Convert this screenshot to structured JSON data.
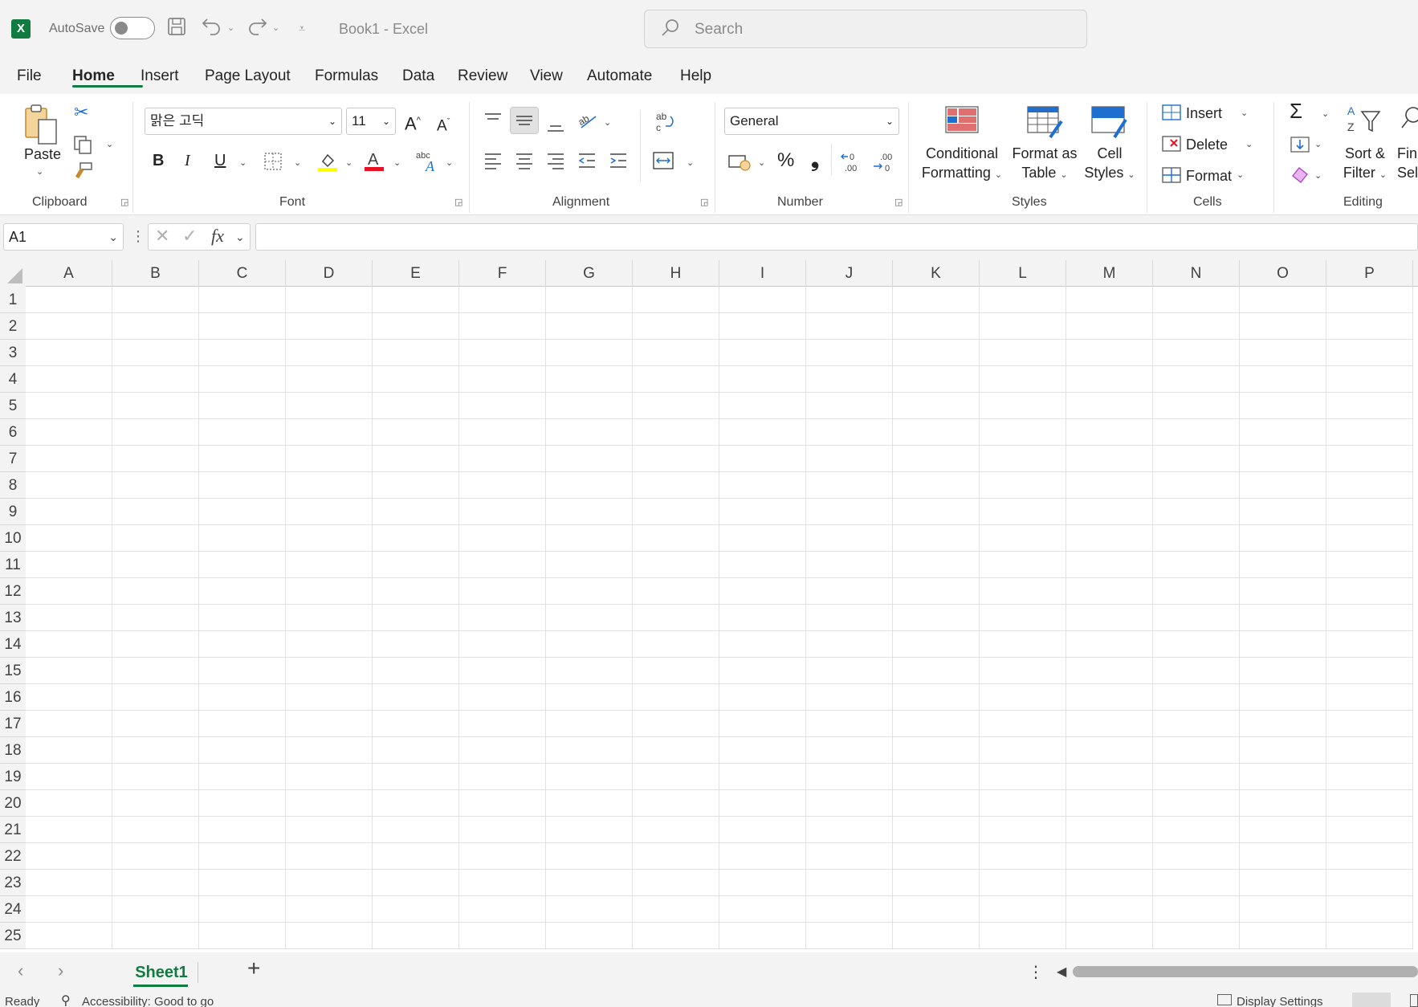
{
  "titlebar": {
    "app_logo": "X",
    "autosave_label": "AutoSave",
    "autosave_on": false,
    "doc_title": "Book1  -  Excel",
    "search_placeholder": "Search"
  },
  "tabs": [
    "File",
    "Home",
    "Insert",
    "Page Layout",
    "Formulas",
    "Data",
    "Review",
    "View",
    "Automate",
    "Help"
  ],
  "active_tab": "Home",
  "ribbon": {
    "clipboard": {
      "paste_label": "Paste",
      "group_label": "Clipboard"
    },
    "font": {
      "font_name": "맑은 고딕",
      "font_size": "11",
      "group_label": "Font"
    },
    "alignment": {
      "group_label": "Alignment"
    },
    "number": {
      "format": "General",
      "percent": "%",
      "comma": "❟",
      "group_label": "Number"
    },
    "styles": {
      "conditional_formatting": [
        "Conditional",
        "Formatting"
      ],
      "format_as_table": [
        "Format as",
        "Table"
      ],
      "cell_styles": [
        "Cell",
        "Styles"
      ],
      "group_label": "Styles"
    },
    "cells": {
      "insert": "Insert",
      "delete": "Delete",
      "format": "Format",
      "group_label": "Cells"
    },
    "editing": {
      "sort_filter": [
        "Sort &",
        "Filter"
      ],
      "find_select": [
        "Fin",
        "Sele"
      ],
      "group_label": "Editing"
    }
  },
  "formula_bar": {
    "name_box": "A1",
    "fx": "fx",
    "formula": ""
  },
  "columns": [
    "A",
    "B",
    "C",
    "D",
    "E",
    "F",
    "G",
    "H",
    "I",
    "J",
    "K",
    "L",
    "M",
    "N",
    "O",
    "P"
  ],
  "rows": [
    "1",
    "2",
    "3",
    "4",
    "5",
    "6",
    "7",
    "8",
    "9",
    "10",
    "11",
    "12",
    "13",
    "14",
    "15",
    "16",
    "17",
    "18",
    "19",
    "20",
    "21",
    "22",
    "23",
    "24",
    "25"
  ],
  "sheets": [
    "Sheet1"
  ],
  "active_sheet": "Sheet1",
  "status": {
    "ready": "Ready",
    "accessibility": "Accessibility: Good to go",
    "display_settings": "Display Settings"
  },
  "colors": {
    "accent": "#107c41"
  }
}
